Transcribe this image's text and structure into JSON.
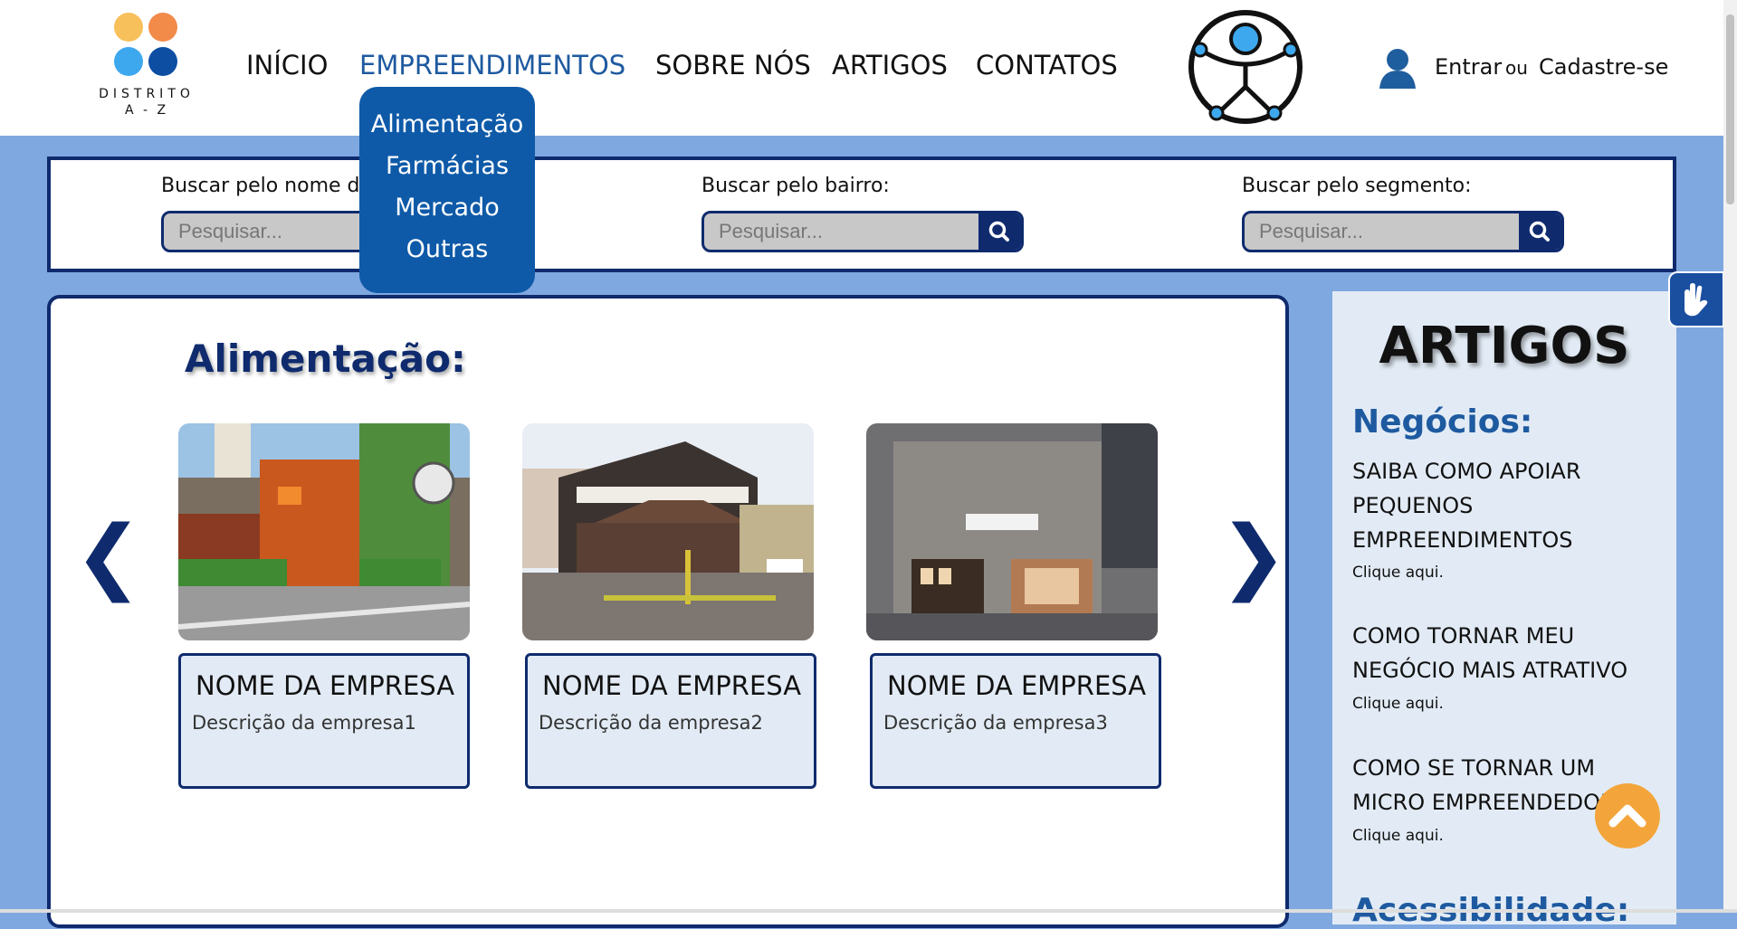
{
  "header": {
    "logo": {
      "line1": "DISTRITO",
      "line2": "A - Z",
      "dot_colors": [
        "#f7c05a",
        "#f28a4a",
        "#3ea8ee",
        "#0d4ea3"
      ]
    },
    "nav": [
      {
        "label": "INÍCIO"
      },
      {
        "label": "EMPREENDIMENTOS"
      },
      {
        "label": "SOBRE NÓS"
      },
      {
        "label": "ARTIGOS"
      },
      {
        "label": "CONTATOS"
      }
    ],
    "dropdown": [
      "Alimentação",
      "Farmácias",
      "Mercado",
      "Outras"
    ],
    "login": {
      "enter": "Entrar",
      "or": "ou",
      "register": "Cadastre-se"
    }
  },
  "search": {
    "fields": [
      {
        "label": "Buscar pelo nome da loja:",
        "placeholder": "Pesquisar..."
      },
      {
        "label": "Buscar pelo bairro:",
        "placeholder": "Pesquisar..."
      },
      {
        "label": "Buscar pelo segmento:",
        "placeholder": "Pesquisar..."
      }
    ]
  },
  "main": {
    "section_title": "Alimentação:",
    "prev_arrow": "❮",
    "next_arrow": "❯",
    "cards": [
      {
        "name": "NOME DA EMPRESA",
        "description": "Descrição da empresa1"
      },
      {
        "name": "NOME DA EMPRESA",
        "description": "Descrição da empresa2"
      },
      {
        "name": "NOME DA EMPRESA",
        "description": "Descrição da empresa3"
      }
    ]
  },
  "articles": {
    "title": "ARTIGOS",
    "categories": [
      {
        "name": "Negócios:"
      },
      {
        "name": "Acessibilidade:"
      }
    ],
    "items": [
      {
        "title": "SAIBA COMO APOIAR PEQUENOS EMPREENDIMENTOS",
        "link": "Clique aqui."
      },
      {
        "title": "COMO TORNAR MEU NEGÓCIO MAIS ATRATIVO",
        "link": "Clique aqui."
      },
      {
        "title": "COMO SE TORNAR UM MICRO EMPREENDEDOR",
        "link": "Clique aqui."
      }
    ]
  },
  "icons": {
    "search": "search-icon",
    "user": "user-icon",
    "accessibility": "accessibility-icon",
    "scroll_top": "chevron-up-icon",
    "sign_language": "hands-icon"
  },
  "colors": {
    "navy": "#0f2b6e",
    "accent_blue": "#1e5aa0",
    "dropdown_bg": "#0e5aa8",
    "page_bg": "#80a8e0",
    "card_bg": "#e2ebf5",
    "scroll_top": "#f3a53b"
  }
}
